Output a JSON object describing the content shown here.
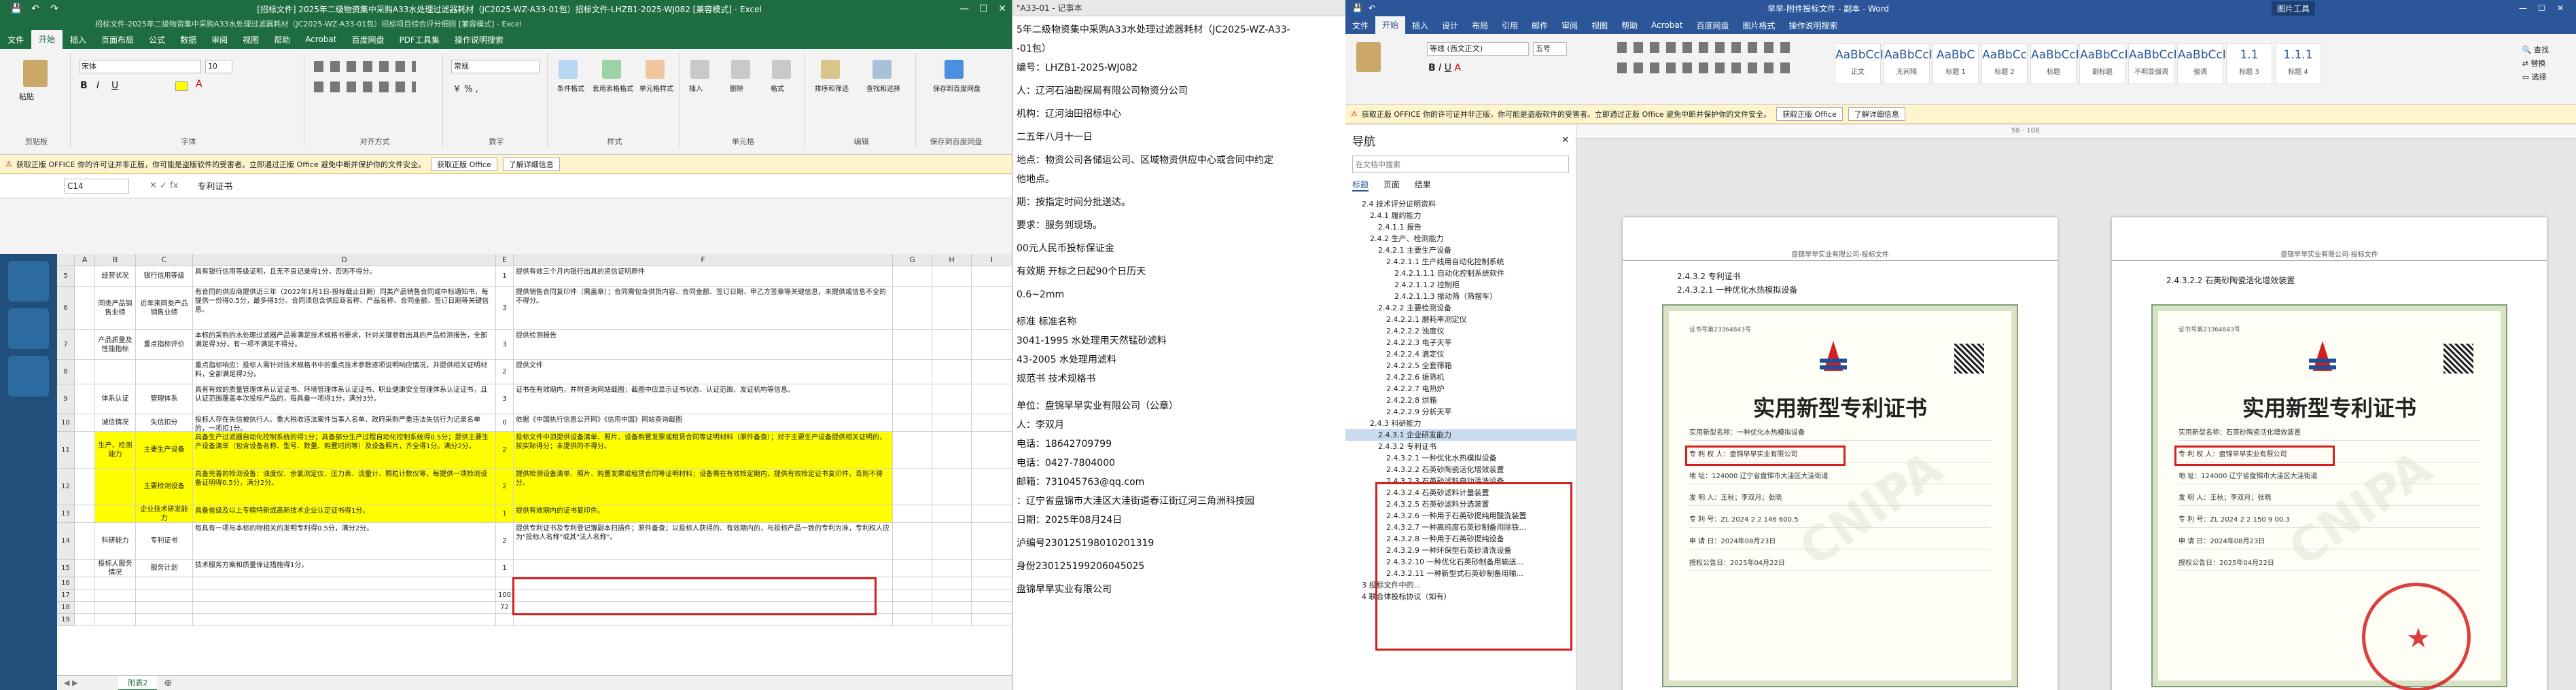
{
  "excel": {
    "title": "[招标文件] 2025年二级物资集中采购A33水处理过滤器耗材（JC2025-WZ-A33-01包）招标文件-LHZB1-2025-WJ082 [兼容模式] - Excel",
    "title2": "招标文件-2025年二级物资集中采购A33水处理过滤器耗材（JC2025-WZ-A33-01包）招标项目综合评分细则 [兼容模式] - Excel",
    "tabs": [
      "文件",
      "开始",
      "插入",
      "页面布局",
      "公式",
      "数据",
      "审阅",
      "视图",
      "帮助",
      "Acrobat",
      "百度网盘",
      "PDF工具集",
      "操作说明搜索"
    ],
    "group_labels": [
      "剪贴板",
      "字体",
      "对齐方式",
      "数字",
      "样式",
      "单元格",
      "编辑",
      "保存到百度网盘"
    ],
    "font_name": "宋体",
    "font_size": "10",
    "number_format": "常规",
    "ribbon_buttons": [
      "粘贴",
      "条件格式",
      "套用表格格式",
      "单元格样式",
      "插入",
      "删除",
      "格式",
      "排序和筛选",
      "查找和选择",
      "保存到百度网盘"
    ],
    "warning": "获取正版 OFFICE  你的许可证并非正版，你可能是盗版软件的受害者。立即通过正版 Office 避免中断并保护你的文件安全。",
    "warn_btn1": "获取正版 Office",
    "warn_btn2": "了解详细信息",
    "name_box": "C14",
    "formula": "专利证书",
    "columns": [
      "A",
      "B",
      "C",
      "D",
      "E",
      "F",
      "G",
      "H",
      "I"
    ],
    "sheet_tab": "附表2",
    "rows": [
      {
        "n": "5",
        "b": "经营状况",
        "c": "银行信用等级",
        "d": "具有银行信用等级证明，且无不良记录得1分，否则不得分。",
        "e": "1",
        "f": "提供有效三个月内银行出具的资信证明原件"
      },
      {
        "n": "6",
        "b": "同类产品销售业绩",
        "c": "近年来同类产品销售业绩",
        "d": "有合同的供应商提供近三年（2022年1月1日-投标截止日期）同类产品销售合同或中标通知书，每提供一份得0.5分，最多得3分。合同须包含供应商名称、产品名称、合同金额、签订日期等关键信息。",
        "e": "3",
        "f": "提供销售合同复印件（需盖章）；合同需包含供货内容、合同金额、签订日期、甲乙方签章等关键信息，未提供或信息不全的不得分。"
      },
      {
        "n": "7",
        "b": "产品质量及性能指标",
        "c": "重点指标评价",
        "d": "本标的采购的水处理过滤器产品需满足技术规格书要求，针对关键参数出具的产品检测报告，全部满足得3分，有一项不满足不得分。",
        "e": "3",
        "f": "提供检测报告"
      },
      {
        "n": "8",
        "b": "",
        "c": "",
        "d": "重点指标响应：投标人需针对技术规格书中的重点技术参数逐项说明响应情况，并提供相关证明材料，全部满足得2分。",
        "e": "2",
        "f": "提供文件"
      },
      {
        "n": "9",
        "b": "体系认证",
        "c": "管理体系",
        "d": "具有有效的质量管理体系认证证书、环境管理体系认证证书、职业健康安全管理体系认证证书，且认证范围覆盖本次投标产品的，每具备一项得1分，满分3分。",
        "e": "3",
        "f": "证书在有效期内，并附查询网站截图；截图中应显示证书状态、认证范围、发证机构等信息。"
      },
      {
        "n": "10",
        "b": "诚信情况",
        "c": "失信扣分",
        "d": "投标人存在失信被执行人、重大税收违法案件当事人名单、政府采购严重违法失信行为记录名单的，一项扣1分。",
        "e": "0",
        "f": "依据《中国执行信息公开网》《信用中国》网站查询截图"
      },
      {
        "n": "11",
        "b": "生产、检测能力",
        "c": "主要生产设备",
        "d": "具备生产过滤器自动化控制系统的得1分；具备部分生产过程自动化控制系统得0.5分；提供主要生产设备清单（包含设备名称、型号、数量、购置时间等）及设备照片，齐全得1分。满分2分。",
        "e": "2",
        "f": "投标文件中须提供设备清单、照片、设备购置发票或租赁合同等证明材料（原件备查）；对于主要生产设备提供相关证明的，按实际得分；未提供的不得分。",
        "y": true
      },
      {
        "n": "12",
        "b": "",
        "c": "主要检测设备",
        "d": "具备完善的检测设备：浊度仪、余氯测定仪、压力表、流量计、颗粒计数仪等，每提供一项检测设备证明得0.5分，满分2分。",
        "e": "2",
        "f": "提供检测设备清单、照片、购置发票或租赁合同等证明材料；设备需在有效检定期内，提供有效检定证书复印件，否则不得分。",
        "y": true
      },
      {
        "n": "13",
        "b": "",
        "c": "企业技术研发能力",
        "d": "具备省级及以上专精特新或高新技术企业认定证书得1分。",
        "e": "1",
        "f": "提供有效期内的证书复印件。",
        "y": true
      },
      {
        "n": "14",
        "b": "科研能力",
        "c": "专利证书",
        "d": "每具有一项与本标的物相关的发明专利得0.5分，满分2分。",
        "e": "2",
        "f": "提供专利证书及专利登记簿副本扫描件；原件备查；以投标人获得的、有效期内的，与投标产品一致的专利为准，专利权人应为\"投标人名称\"或其\"法人名称\"。"
      },
      {
        "n": "15",
        "b": "投标人服务情况",
        "c": "服务计划",
        "d": "技术服务方案和质量保证措施得1分。",
        "e": "1",
        "f": ""
      },
      {
        "n": "16",
        "b": "",
        "c": "",
        "d": "",
        "e": "",
        "f": ""
      },
      {
        "n": "17",
        "b": "",
        "c": "",
        "d": "",
        "e": "100",
        "f": ""
      },
      {
        "n": "18",
        "b": "",
        "c": "",
        "d": "",
        "e": "72",
        "f": ""
      },
      {
        "n": "19",
        "b": "",
        "c": "",
        "d": "",
        "e": "",
        "f": ""
      }
    ]
  },
  "pdf": {
    "top": "\"A33-01 - 记事本",
    "lines": [
      "5年二级物资集中采购A33水处理过滤器耗材（JC2025-WZ-A33-",
      "-01包）",
      "编号：LHZB1-2025-WJ082",
      "",
      "人：辽河石油勘探局有限公司物资分公司",
      "",
      "机构：辽河油田招标中心",
      "",
      "二五年八月十一日",
      "",
      "地点：物资公司各储运公司、区域物资供应中心或合同中约定",
      "他地点。",
      "",
      "期：按指定时间分批送达。",
      "",
      "要求：服务到现场。",
      "",
      "00元人民币投标保证金",
      "",
      "有效期          开标之日起90个日历天",
      "",
      "0.6~2mm",
      "",
      "",
      "标准    标准名称",
      "3041-1995          水处理用天然锰砂滤料",
      "43-2005          水处理用滤料",
      "规范书          技术规格书",
      "",
      "",
      "单位：盘锦早早实业有限公司（公章）",
      "人：李双月",
      "电话：18642709799",
      "电话：0427-7804000",
      "邮箱：731045763@qq.com",
      "：辽宁省盘锦市大洼区大洼街道春江街辽河三角洲科技园",
      "日期：2025年08月24日",
      "",
      "泸编号230125198010201319",
      "",
      "身份230125199206045025",
      "",
      "盘锦早早实业有限公司"
    ]
  },
  "word": {
    "title": "早早-附件投标文件 - 副本 - Word",
    "tools_tab": "图片工具",
    "tabs": [
      "文件",
      "开始",
      "插入",
      "设计",
      "布局",
      "引用",
      "邮件",
      "审阅",
      "视图",
      "帮助",
      "Acrobat",
      "百度网盘",
      "图片格式",
      "操作说明搜索"
    ],
    "font_name": "等线 (西文正文)",
    "font_size": "五号",
    "styles": [
      {
        "big": "AaBbCcI",
        "sm": "正文"
      },
      {
        "big": "AaBbCcI",
        "sm": "无间隔"
      },
      {
        "big": "AaBbC",
        "sm": "标题 1"
      },
      {
        "big": "AaBbCc",
        "sm": "标题 2"
      },
      {
        "big": "AaBbCcI",
        "sm": "标题"
      },
      {
        "big": "AaBbCcI",
        "sm": "副标题"
      },
      {
        "big": "AaBbCcI",
        "sm": "不明显强调"
      },
      {
        "big": "AaBbCcI",
        "sm": "强调"
      },
      {
        "big": "1.1",
        "sm": "标题 3"
      },
      {
        "big": "1.1.1",
        "sm": "标题 4"
      }
    ],
    "warning": "获取正版 OFFICE  你的许可证并非正版，你可能是盗版软件的受害者。立即通过正版 Office 避免中断并保护你的文件安全。",
    "warn_btn1": "获取正版 Office",
    "warn_btn2": "了解详细信息",
    "nav_title": "导航",
    "nav_search": "在文档中搜索",
    "nav_tabs": [
      "标题",
      "页面",
      "结果"
    ],
    "nav_items": [
      {
        "t": "2.4 技术评分证明资料",
        "i": 1
      },
      {
        "t": "2.4.1 履约能力",
        "i": 2
      },
      {
        "t": "2.4.1.1 报告",
        "i": 3
      },
      {
        "t": "2.4.2 生产、检测能力",
        "i": 2
      },
      {
        "t": "2.4.2.1 主要生产设备",
        "i": 3
      },
      {
        "t": "2.4.2.1.1 生产线用自动化控制系统",
        "i": 4
      },
      {
        "t": "2.4.2.1.1.1 自动化控制系统软件",
        "i": 5
      },
      {
        "t": "2.4.2.1.1.2 控制柜",
        "i": 5
      },
      {
        "t": "2.4.2.1.1.3 振动筛（筛摆车）",
        "i": 5
      },
      {
        "t": "2.4.2.2 主要检测设备",
        "i": 3
      },
      {
        "t": "2.4.2.2.1 磨耗率测定仪",
        "i": 4
      },
      {
        "t": "2.4.2.2.2 浊度仪",
        "i": 4
      },
      {
        "t": "2.4.2.2.3 电子天平",
        "i": 4
      },
      {
        "t": "2.4.2.2.4 滴定仪",
        "i": 4
      },
      {
        "t": "2.4.2.2.5 全套筛箱",
        "i": 4
      },
      {
        "t": "2.4.2.2.6 振筛机",
        "i": 4
      },
      {
        "t": "2.4.2.2.7 电热炉",
        "i": 4
      },
      {
        "t": "2.4.2.2.8 烘箱",
        "i": 4
      },
      {
        "t": "2.4.2.2.9 分析天平",
        "i": 4
      },
      {
        "t": "2.4.3 科研能力",
        "i": 2
      },
      {
        "t": "2.4.3.1 企业研发能力",
        "i": 3,
        "sel": true
      },
      {
        "t": "2.4.3.2 专利证书",
        "i": 3
      },
      {
        "t": "2.4.3.2.1 一种优化水热模拟设备",
        "i": 4
      },
      {
        "t": "2.4.3.2.2 石英砂陶瓷活化增效装置",
        "i": 4
      },
      {
        "t": "2.4.3.2.3 石英砂滤料自动清洗设备",
        "i": 4
      },
      {
        "t": "2.4.3.2.4 石英砂滤料计量装置",
        "i": 4
      },
      {
        "t": "2.4.3.2.5 石英砂滤料分选装置",
        "i": 4
      },
      {
        "t": "2.4.3.2.6 一种用于石英砂提纯用酸洗装置",
        "i": 4
      },
      {
        "t": "2.4.3.2.7 一种高纯度石英砂制备用除铁...",
        "i": 4
      },
      {
        "t": "2.4.3.2.8 一种用于石英砂提纯设备",
        "i": 4
      },
      {
        "t": "2.4.3.2.9 一种环保型石英砂清洗设备",
        "i": 4
      },
      {
        "t": "2.4.3.2.10 一种优化石英砂制备用输送...",
        "i": 4
      },
      {
        "t": "2.4.3.2.11 一种新型式石英砂制备用输...",
        "i": 4
      },
      {
        "t": "3 投标文件中的...",
        "i": 1
      },
      {
        "t": "4 联合体投标协议（如有）",
        "i": 1
      }
    ],
    "page_header": "盘锦早早实业有限公司-投标文件",
    "page1_h1": "2.4.3.2   专利证书",
    "page1_h2": "2.4.3.2.1   一种优化水热模拟设备",
    "page2_h2": "2.4.3.2.2   石英砂陶瓷活化增效装置",
    "ruler_text": "58 · 108",
    "cert_title": "实用新型专利证书",
    "cert_no": "证书号第23364843号",
    "cert_no2": "证书号第23364843号",
    "cert_lines": [
      "实用新型名称：一种优化水热模拟设备",
      "专 利 权 人：盘锦早早实业有限公司",
      "地    址：124000 辽宁省盘锦市大洼区大洼街道",
      "发 明 人：王秋；李双月；张晓",
      "专 利 号：ZL 2024 2 2 146 600.5",
      "申 请 日：2024年08月23日",
      "授权公告日：2025年04月22日"
    ],
    "cert_lines2": [
      "实用新型名称：石英砂陶瓷活化增效装置",
      "专 利 权 人：盘锦早早实业有限公司",
      "地    址：124000 辽宁省盘锦市大洼区大洼街道",
      "发 明 人：王秋；李双月；张晓",
      "专 利 号：ZL 2024 2 2 150 9 00.3",
      "申 请 日：2024年08月23日",
      "授权公告日：2025年04月22日"
    ],
    "cnipa": "CNIPA",
    "stamp_text": "盘锦早早实业有限公司"
  }
}
